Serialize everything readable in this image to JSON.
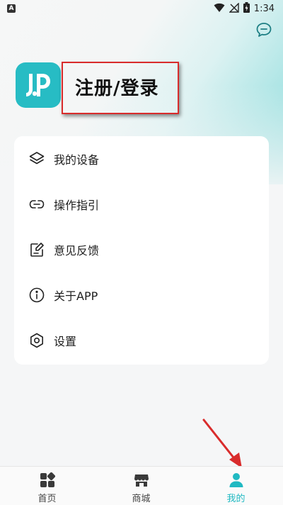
{
  "status_bar": {
    "time": "1:34",
    "left_icon": "a-letter-icon",
    "icons": [
      "wifi-icon",
      "no-signal-icon",
      "battery-icon"
    ]
  },
  "header": {
    "login_label": "注册/登录",
    "chat_icon": "chat-bubble-icon",
    "brand_color": "#27bcc4"
  },
  "menu": {
    "items": [
      {
        "label": "我的设备",
        "icon": "layers-icon"
      },
      {
        "label": "操作指引",
        "icon": "link-icon"
      },
      {
        "label": "意见反馈",
        "icon": "feedback-edit-icon"
      },
      {
        "label": "关于APP",
        "icon": "info-icon"
      },
      {
        "label": "设置",
        "icon": "gear-icon"
      }
    ]
  },
  "bottom_nav": {
    "active_color": "#20b9c2",
    "tabs": [
      {
        "label": "首页",
        "icon": "grid-home-icon",
        "active": false
      },
      {
        "label": "商城",
        "icon": "store-icon",
        "active": false
      },
      {
        "label": "我的",
        "icon": "person-icon",
        "active": true
      }
    ]
  },
  "annotation": {
    "highlight_color": "#d92c2c"
  }
}
